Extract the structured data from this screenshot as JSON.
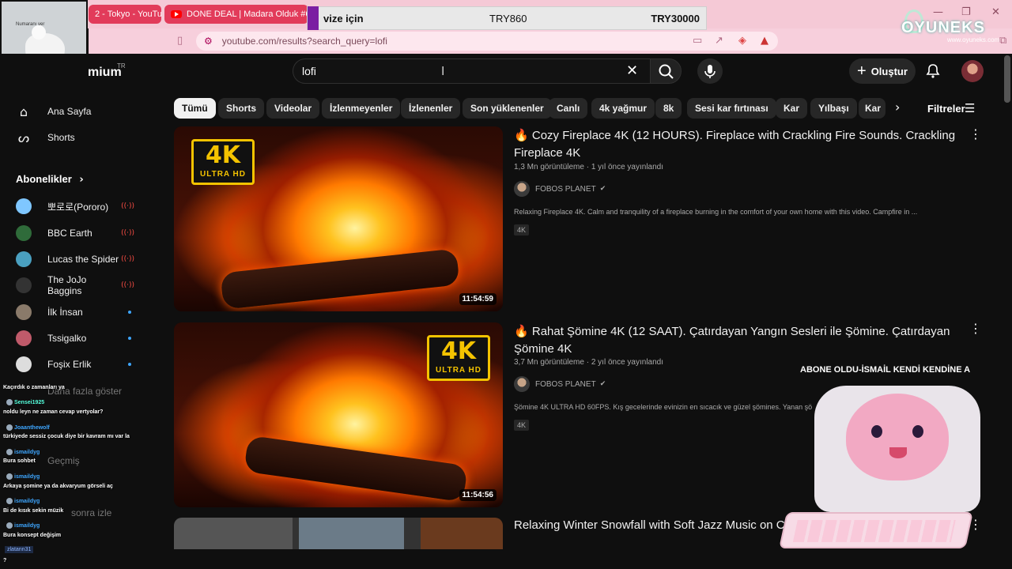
{
  "browser": {
    "tabs": [
      {
        "label": "2 - Tokyo - YouTub"
      },
      {
        "label": "DONE DEAL | Madara Olduk #629"
      }
    ],
    "url": "youtube.com/results?search_query=lofi",
    "window_controls": {
      "minimize": "—",
      "restore": "❐",
      "close": "✕"
    }
  },
  "overlay": {
    "price_label": "vize için",
    "price1": "TRY860",
    "price2": "TRY30000",
    "webcam_caption": "Numaranı ver",
    "logo": "OYUNEKS",
    "logo_sub": "www.oyuneks.com",
    "ticker": "ABONE OLDU-İSMAİL KENDİ KENDİNE A"
  },
  "header": {
    "brand": "mium",
    "country": "TR",
    "search_value": "lofi",
    "create_label": "Oluştur"
  },
  "chips": [
    "Tümü",
    "Shorts",
    "Videolar",
    "İzlenmeyenler",
    "İzlenenler",
    "Son yüklenenler",
    "Canlı",
    "4k yağmur",
    "8k",
    "Sesi kar fırtınası",
    "Kar",
    "Yılbaşı",
    "Kar"
  ],
  "filters_label": "Filtreler",
  "sidebar": {
    "nav": [
      {
        "label": "Ana Sayfa",
        "icon": "home-icon"
      },
      {
        "label": "Shorts",
        "icon": "shorts-icon"
      }
    ],
    "subs_heading": "Abonelikler",
    "subs": [
      {
        "name": "뽀로로(Pororo)",
        "status": "live",
        "color": "#7fc7ff"
      },
      {
        "name": "BBC Earth",
        "status": "live",
        "color": "#2f6b3a"
      },
      {
        "name": "Lucas the Spider",
        "status": "live",
        "color": "#4aa0c0"
      },
      {
        "name": "The JoJo Baggins",
        "status": "live",
        "color": "#333333"
      },
      {
        "name": "İlk İnsan",
        "status": "new",
        "color": "#8a7a6a"
      },
      {
        "name": "Tssigalko",
        "status": "new",
        "color": "#c05a6a"
      },
      {
        "name": "Foşix Erlik",
        "status": "new",
        "color": "#dddddd"
      }
    ],
    "show_more": "Daha fazla göster",
    "history": "Geçmiş",
    "watch_later": "sonra izle"
  },
  "videos": [
    {
      "title": "Cozy Fireplace 4K (12 HOURS). Fireplace with Crackling Fire Sounds. Crackling Fireplace 4K",
      "views": "1,3 Mn görüntüleme",
      "age": "1 yıl önce yayınlandı",
      "channel": "FOBOS PLANET",
      "desc": "Relaxing Fireplace 4K. Calm and tranquility of a fireplace burning in the comfort of your own home with this video. Campfire in ...",
      "tag": "4K",
      "duration": "11:54:59",
      "badge_big": "4K",
      "badge_small": "ULTRA HD"
    },
    {
      "title": "Rahat Şömine 4K (12 SAAT). Çatırdayan Yangın Sesleri ile Şömine. Çatırdayan Şömine 4K",
      "views": "3,7 Mn görüntüleme",
      "age": "2 yıl önce yayınlandı",
      "channel": "FOBOS PLANET",
      "desc": "Şömine 4K ULTRA HD 60FPS. Kış gecelerinde evinizin en sıcacık ve güzel şömines. Yanan şö",
      "tag": "4K",
      "duration": "11:54:56",
      "badge_big": "4K",
      "badge_small": "ULTRA HD"
    },
    {
      "title": "Relaxing Winter Snowfall with Soft Jazz Music on Co"
    }
  ],
  "chat": [
    {
      "user": "",
      "msg": "Kaçırdık o zamanları ya"
    },
    {
      "user": "Sensei1925",
      "msg": "noldu leyn ne zaman cevap vertyolar?"
    },
    {
      "user": "Joaanthewolf",
      "msg": "türkiyede sessiz çocuk diye bir kavram mı var la"
    },
    {
      "user": "ismaildyg",
      "msg": "Bura sohbet"
    },
    {
      "user": "ismaildyg",
      "msg": "Arkaya şomine ya da akvaryum görseli aç"
    },
    {
      "user": "ismaildyg",
      "msg": "Bi de kısık sekin müzik"
    },
    {
      "user": "ismaildyg",
      "msg": "Bura konsept değişim"
    }
  ],
  "chat_tag": "zlatann31",
  "chat_tail": "?",
  "icons": {
    "home": "⌂",
    "shorts": "ᔕ",
    "chevron": "›",
    "search": "⌕",
    "mic": "🎙",
    "bell": "🔔",
    "plus": "+",
    "kebab": "⋮",
    "filters": "☰",
    "live": "((·))",
    "verified": "✔",
    "clear": "✕",
    "text_cursor": "I"
  }
}
